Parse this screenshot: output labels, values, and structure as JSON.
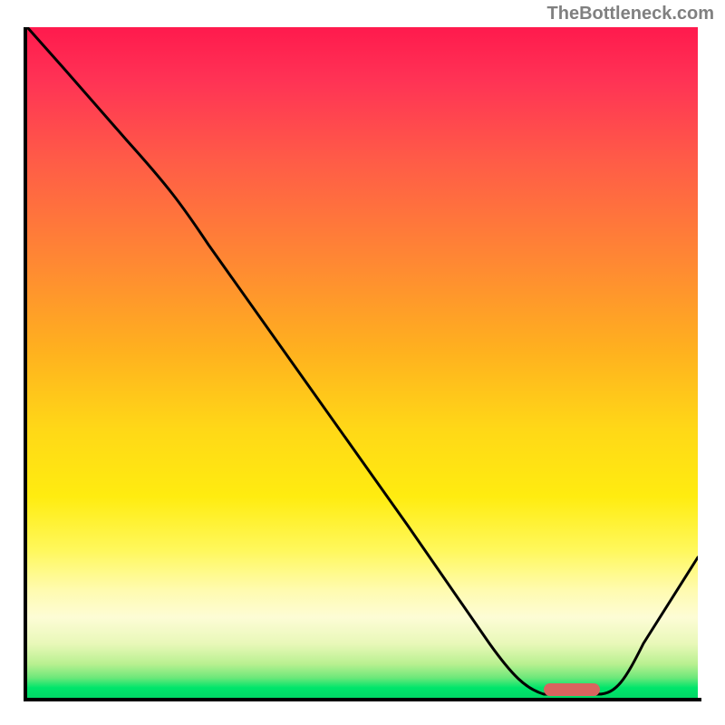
{
  "watermark": "TheBottleneck.com",
  "chart_data": {
    "type": "line",
    "title": "",
    "xlabel": "",
    "ylabel": "",
    "xlim": [
      0,
      100
    ],
    "ylim": [
      0,
      100
    ],
    "background_gradient": {
      "description": "vertical red-to-green via yellow",
      "stops": [
        {
          "pos": 0,
          "color": "#ff1a4d"
        },
        {
          "pos": 50,
          "color": "#ffd020"
        },
        {
          "pos": 85,
          "color": "#fff85c"
        },
        {
          "pos": 100,
          "color": "#00d865"
        }
      ]
    },
    "series": [
      {
        "name": "bottleneck-curve",
        "x": [
          0,
          5,
          15,
          25,
          40,
          55,
          70,
          77,
          82,
          85,
          100
        ],
        "y": [
          100,
          94,
          83,
          72,
          51,
          30,
          10,
          1,
          0,
          0,
          21
        ]
      }
    ],
    "annotations": [
      {
        "name": "optimal-range-marker",
        "type": "bar",
        "x_range": [
          77,
          85
        ],
        "y": 0,
        "color": "#d9645f"
      }
    ]
  }
}
